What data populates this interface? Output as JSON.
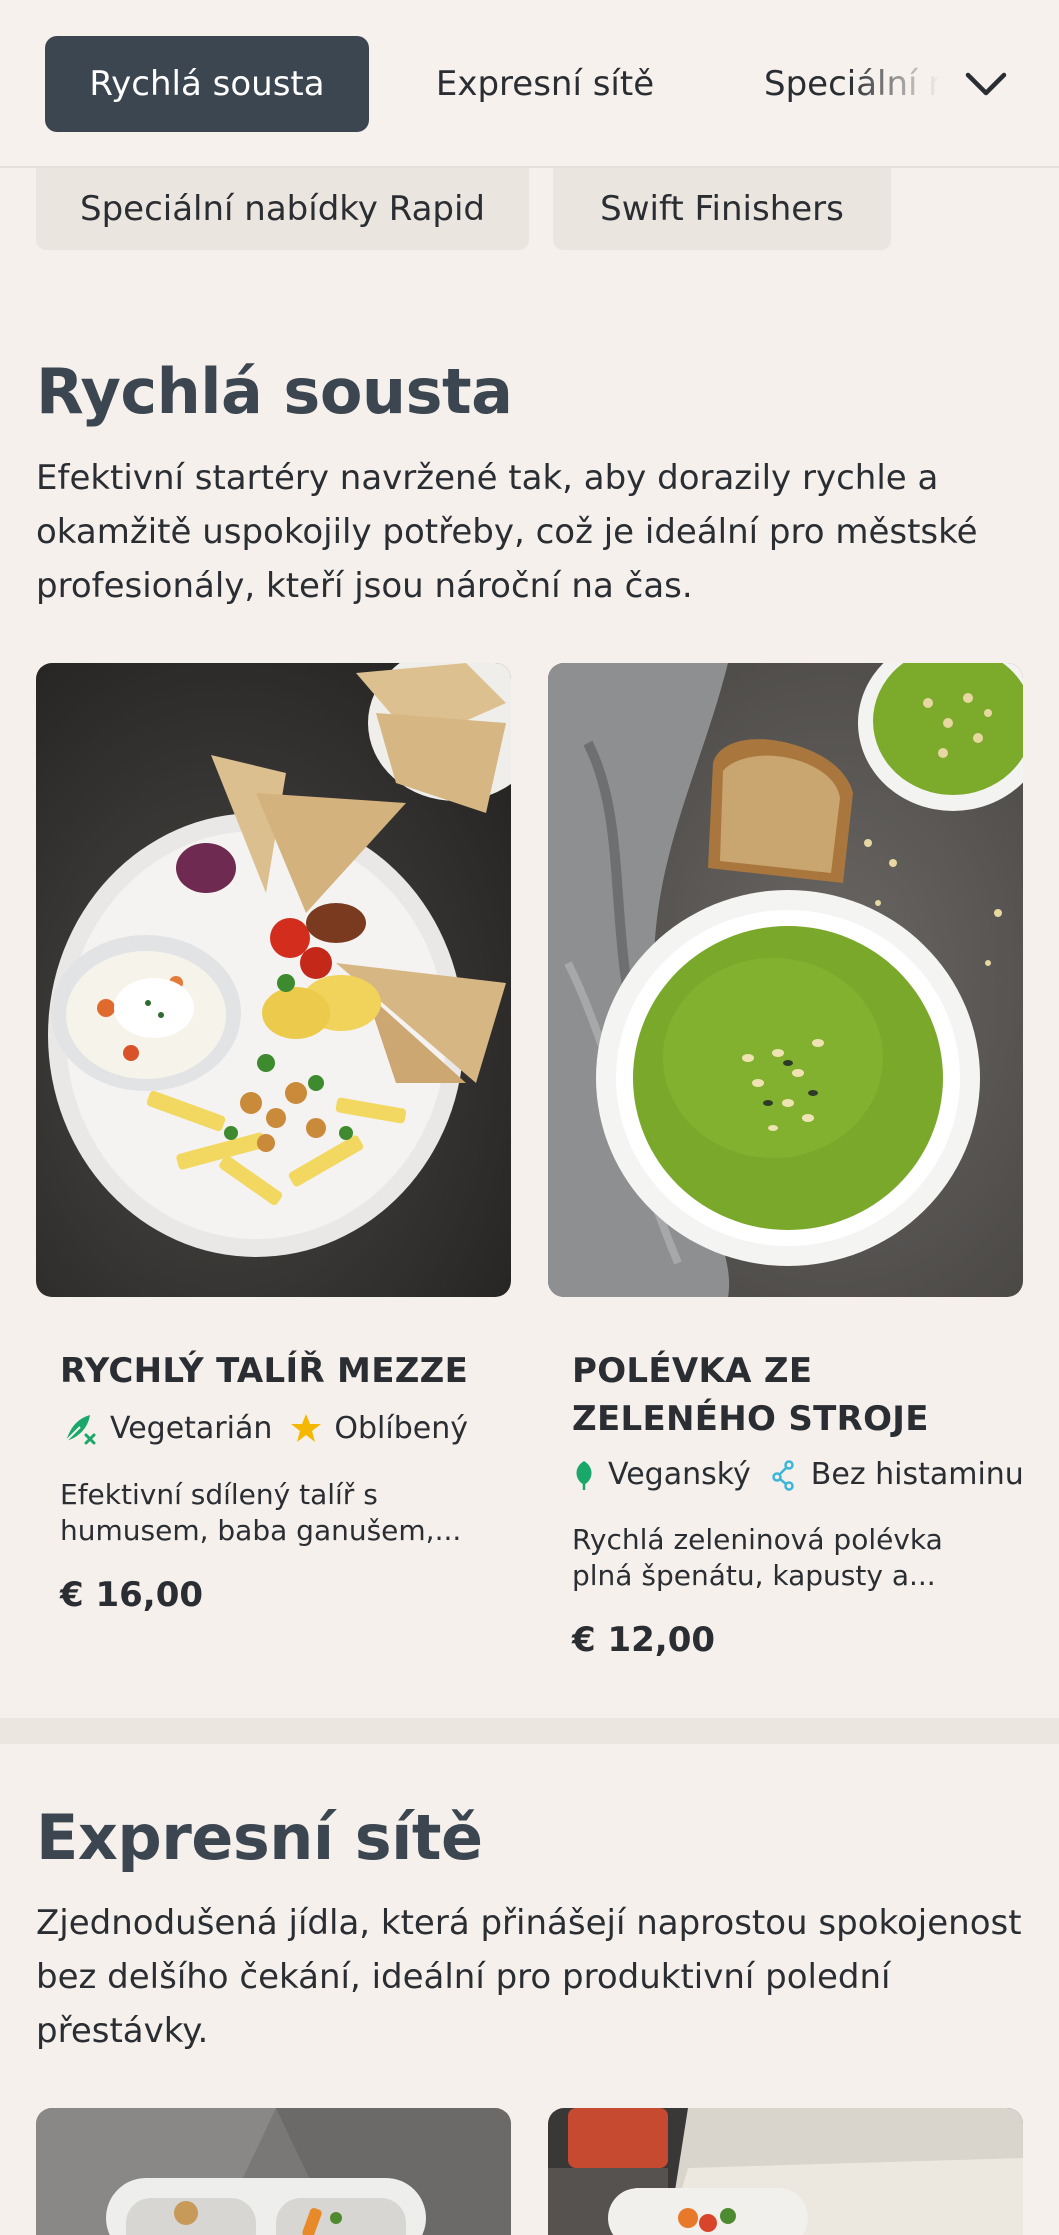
{
  "nav": {
    "tabs": [
      "Rychlá sousta",
      "Expresní sítě",
      "Speciální nabídky Rapid"
    ],
    "active_index": 0
  },
  "subnav": {
    "pills": [
      "Speciální nabídky Rapid",
      "Swift Finishers"
    ]
  },
  "sections": [
    {
      "title": "Rychlá sousta",
      "description": "Efektivní startéry navržené tak, aby dorazily rychle a okamžitě uspokojily potřeby, což je ideální pro městské profesionály, kteří jsou nároční na čas.",
      "items": [
        {
          "name": "RYCHLÝ TALÍŘ MEZZE",
          "tags": [
            {
              "label": "Vegetarián",
              "icon": "vegetarian-icon",
              "color": "#1aa86a"
            },
            {
              "label": "Oblíbený",
              "icon": "star-icon",
              "color": "#f5b800"
            }
          ],
          "description": "Efektivní sdílený talíř s humusem, baba ganušem,...",
          "price": "€ 16,00"
        },
        {
          "name": "POLÉVKA ZE ZELENÉHO STROJE",
          "tags": [
            {
              "label": "Veganský",
              "icon": "vegan-leaf-icon",
              "color": "#1aa86a"
            },
            {
              "label": "Bez histaminu",
              "icon": "histamine-free-icon",
              "color": "#3bb6d8"
            }
          ],
          "description": "Rychlá zeleninová polévka plná špenátu, kapusty a...",
          "price": "€ 12,00"
        }
      ]
    },
    {
      "title": "Expresní sítě",
      "description": "Zjednodušená jídla, která přinášejí naprostou spokojenost bez delšího čekání, ideální pro produktivní polední přestávky."
    }
  ],
  "colors": {
    "background": "#f5f0ec",
    "active_tab": "#3c4650",
    "heading": "#3c4650"
  }
}
